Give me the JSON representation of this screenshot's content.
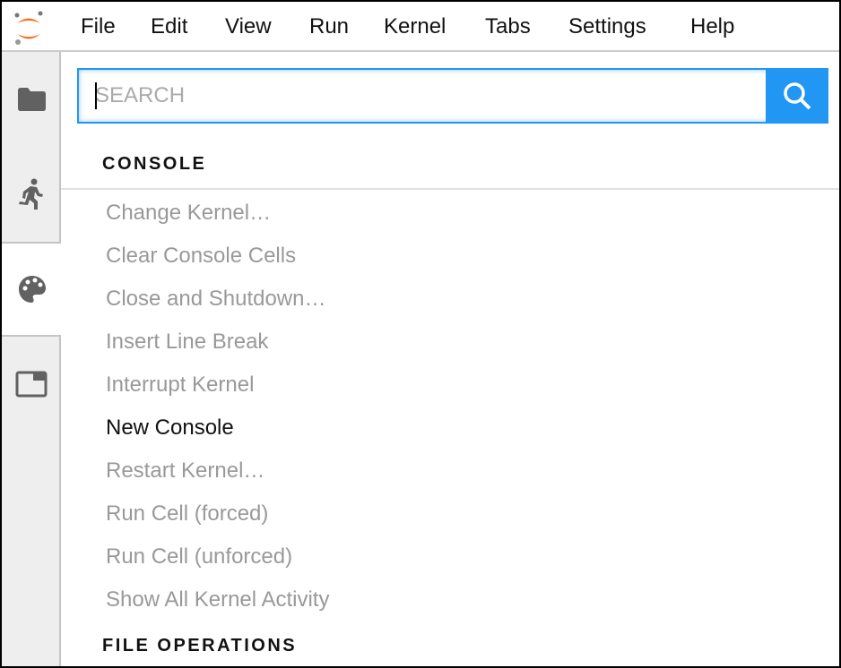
{
  "menubar": {
    "items": [
      "File",
      "Edit",
      "View",
      "Run",
      "Kernel",
      "Tabs",
      "Settings",
      "Help"
    ]
  },
  "sidebar": {
    "tabs": [
      {
        "icon": "folder-icon"
      },
      {
        "icon": "running-icon"
      },
      {
        "icon": "palette-icon",
        "active": true
      },
      {
        "icon": "tabs-icon"
      }
    ]
  },
  "search": {
    "placeholder": "SEARCH",
    "value": ""
  },
  "colors": {
    "accent": "#2196f3",
    "logo": "#f37626"
  },
  "palette": {
    "categories": [
      {
        "label": "CONSOLE",
        "items": [
          {
            "label": "Change Kernel…",
            "enabled": false
          },
          {
            "label": "Clear Console Cells",
            "enabled": false
          },
          {
            "label": "Close and Shutdown…",
            "enabled": false
          },
          {
            "label": "Insert Line Break",
            "enabled": false
          },
          {
            "label": "Interrupt Kernel",
            "enabled": false
          },
          {
            "label": "New Console",
            "enabled": true
          },
          {
            "label": "Restart Kernel…",
            "enabled": false
          },
          {
            "label": "Run Cell (forced)",
            "enabled": false
          },
          {
            "label": "Run Cell (unforced)",
            "enabled": false
          },
          {
            "label": "Show All Kernel Activity",
            "enabled": false
          }
        ]
      },
      {
        "label": "FILE OPERATIONS",
        "items": []
      }
    ]
  }
}
